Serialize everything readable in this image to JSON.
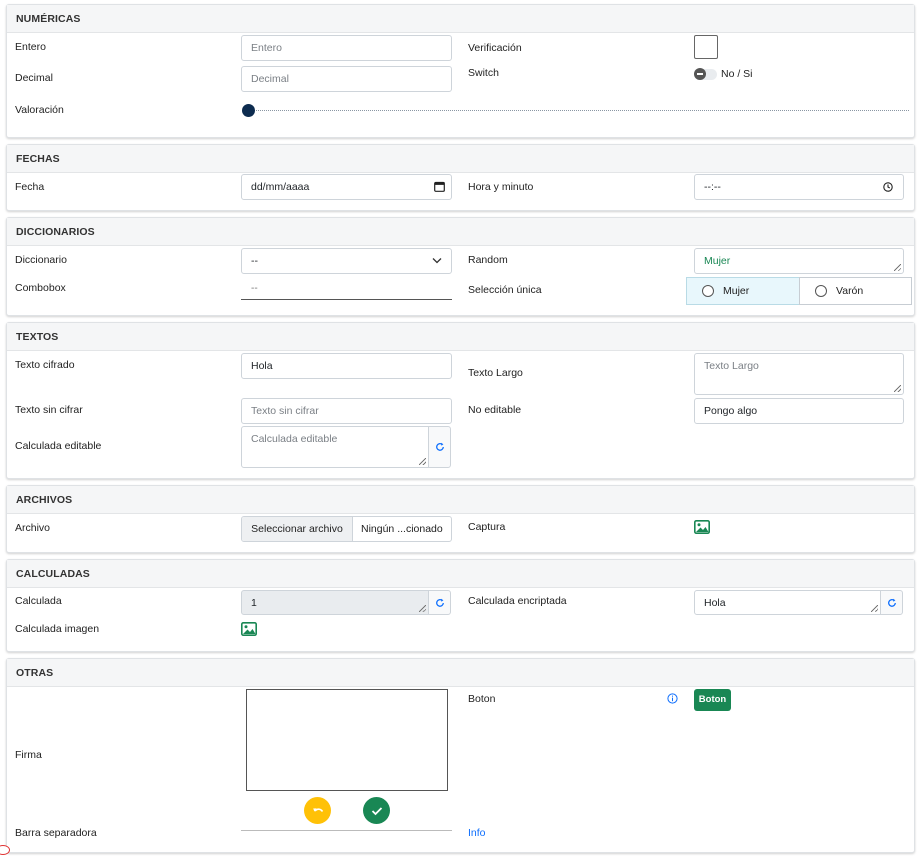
{
  "numericas": {
    "title": "NUMÉRICAS",
    "entero_label": "Entero",
    "entero_placeholder": "Entero",
    "decimal_label": "Decimal",
    "decimal_placeholder": "Decimal",
    "valoracion_label": "Valoración",
    "valoracion_value": 0,
    "verificacion_label": "Verificación",
    "switch_label": "Switch",
    "switch_text": "No / Si"
  },
  "fechas": {
    "title": "FECHAS",
    "fecha_label": "Fecha",
    "fecha_value": "dd/mm/aaaa",
    "hora_label": "Hora y minuto",
    "hora_value": "--:--"
  },
  "diccionarios": {
    "title": "DICCIONARIOS",
    "diccionario_label": "Diccionario",
    "diccionario_value": "--",
    "combobox_label": "Combobox",
    "combobox_value": "--",
    "random_label": "Random",
    "random_value": "Mujer",
    "seleccion_label": "Selección única",
    "options": [
      "Mujer",
      "Varón"
    ]
  },
  "textos": {
    "title": "TEXTOS",
    "cifrado_label": "Texto cifrado",
    "cifrado_value": "Hola",
    "sin_cifrar_label": "Texto sin cifrar",
    "sin_cifrar_placeholder": "Texto sin cifrar",
    "calculada_editable_label": "Calculada editable",
    "calculada_editable_placeholder": "Calculada editable",
    "largo_label": "Texto Largo",
    "largo_placeholder": "Texto Largo",
    "no_editable_label": "No editable",
    "no_editable_value": "Pongo algo"
  },
  "archivos": {
    "title": "ARCHIVOS",
    "archivo_label": "Archivo",
    "select_button": "Seleccionar archivo",
    "file_status": "Ningún ...cionado",
    "captura_label": "Captura"
  },
  "calculadas": {
    "title": "CALCULADAS",
    "calculada_label": "Calculada",
    "calculada_value": "1",
    "imagen_label": "Calculada imagen",
    "encriptada_label": "Calculada encriptada",
    "encriptada_value": "Hola"
  },
  "otras": {
    "title": "OTRAS",
    "firma_label": "Firma",
    "boton_label": "Boton",
    "boton_text": "Boton",
    "barra_label": "Barra separadora",
    "info_text": "Info"
  },
  "colors": {
    "green": "#198754",
    "blue": "#0d6efd",
    "yellow": "#ffc107",
    "slider": "#0d2c4f"
  },
  "icons": [
    "calendar-icon",
    "clock-icon",
    "chevron-down-icon",
    "refresh-icon",
    "image-icon",
    "undo-icon",
    "check-icon",
    "info-icon"
  ]
}
